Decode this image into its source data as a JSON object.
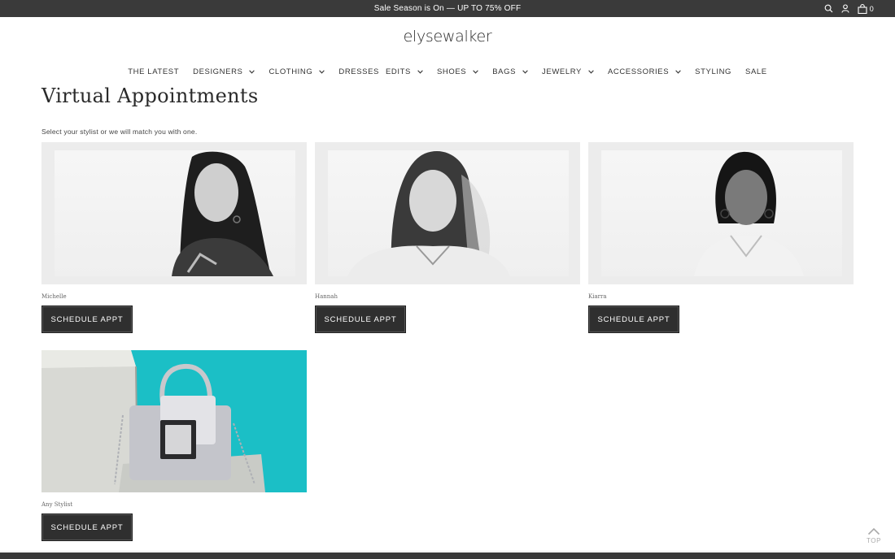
{
  "promo": {
    "text": "Sale Season is On — UP TO 75% OFF"
  },
  "header": {
    "logo": "elysewalker",
    "cart_count": "0",
    "icons": [
      "search-icon",
      "user-icon",
      "cart-icon"
    ]
  },
  "nav": {
    "items": [
      {
        "label": "THE LATEST",
        "dropdown": false
      },
      {
        "label": "DESIGNERS",
        "dropdown": true
      },
      {
        "label": "CLOTHING",
        "dropdown": true
      },
      {
        "label": "DRESSES",
        "dropdown": false
      },
      {
        "label": "EDITS",
        "dropdown": true
      },
      {
        "label": "SHOES",
        "dropdown": true
      },
      {
        "label": "BAGS",
        "dropdown": true
      },
      {
        "label": "JEWELRY",
        "dropdown": true
      },
      {
        "label": "ACCESSORIES",
        "dropdown": true
      },
      {
        "label": "STYLING",
        "dropdown": false
      },
      {
        "label": "SALE",
        "dropdown": false
      }
    ]
  },
  "page": {
    "title": "Virtual Appointments",
    "intro": "Select your stylist or we will match you with one."
  },
  "stylists": [
    {
      "name": "Michelle",
      "button": "SCHEDULE APPT"
    },
    {
      "name": "Hannah",
      "button": "SCHEDULE APPT"
    },
    {
      "name": "Kiarra",
      "button": "SCHEDULE APPT"
    },
    {
      "name": "Any Stylist",
      "button": "SCHEDULE APPT"
    }
  ],
  "back_to_top": {
    "label": "TOP"
  },
  "colors": {
    "promo_bg": "#3a3a3a",
    "button_bg": "#2f2f2f",
    "bag_bg": "#1cc1c7"
  }
}
